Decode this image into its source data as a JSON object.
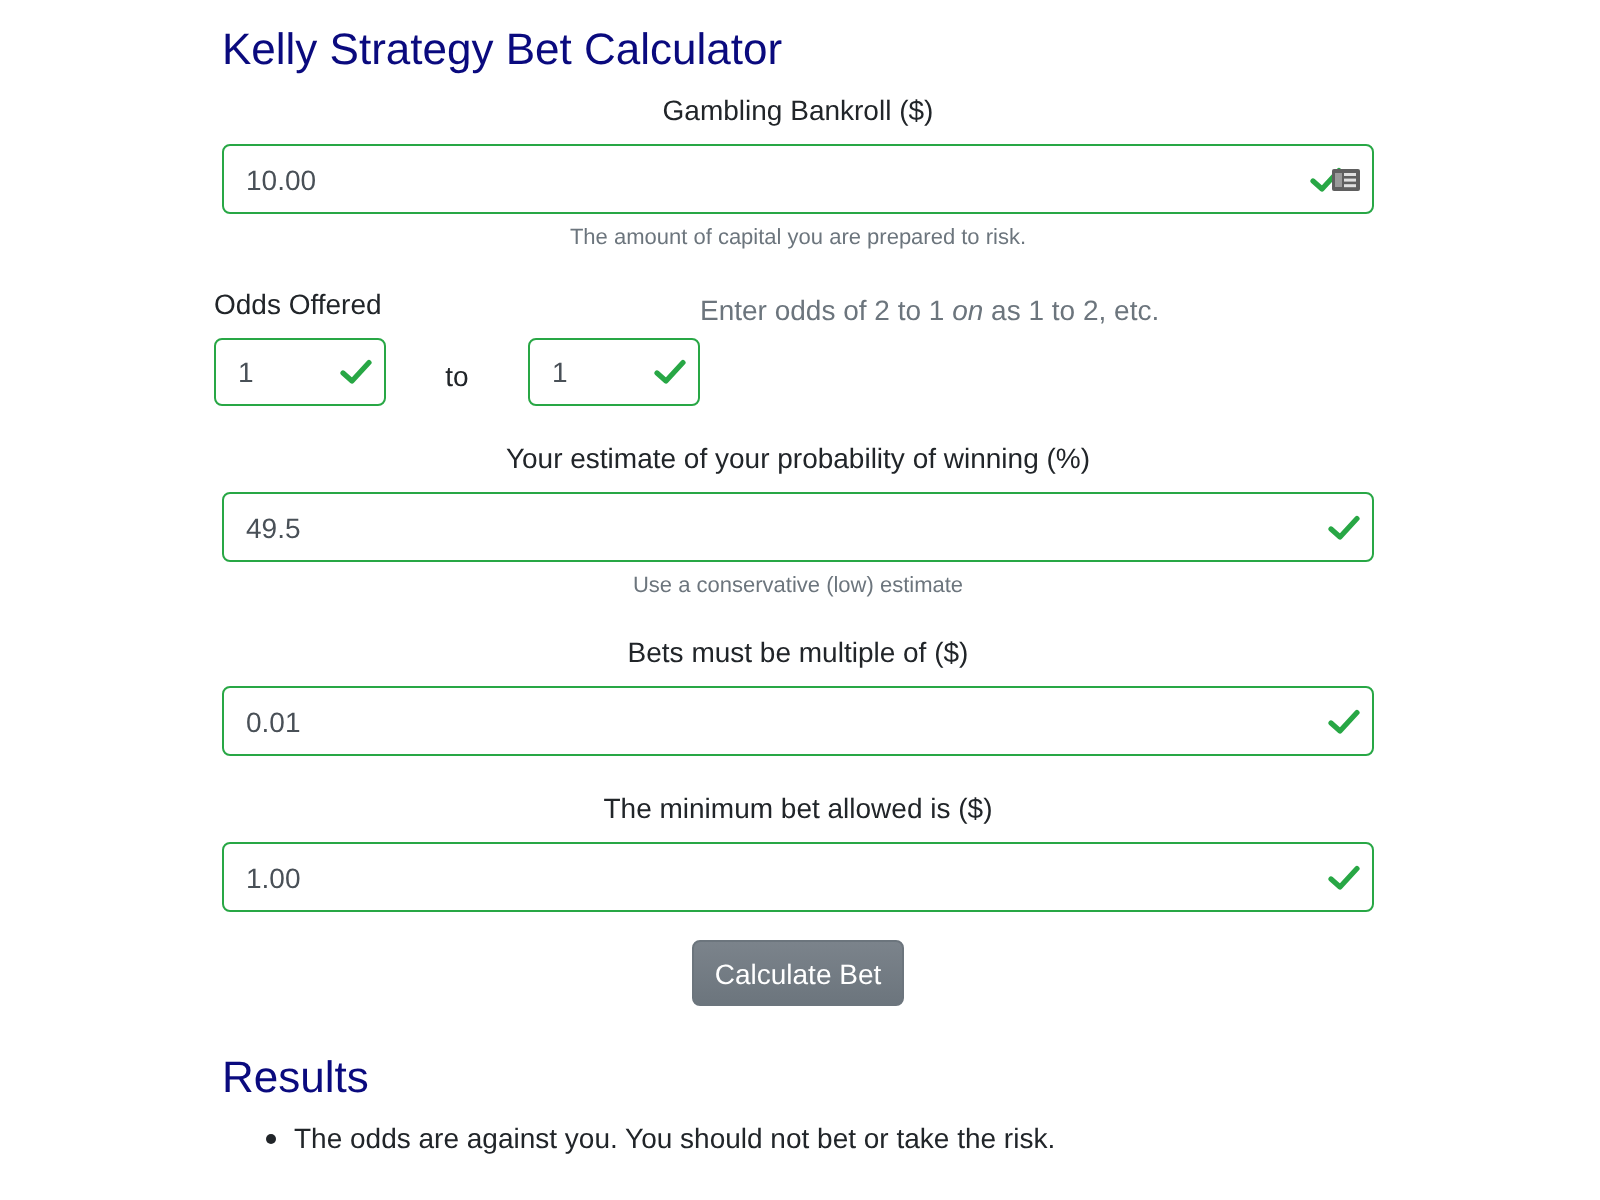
{
  "title": "Kelly Strategy Bet Calculator",
  "form": [
    {
      "kind": "field",
      "label": "Gambling Bankroll ($)",
      "value": "10.00",
      "valid": true,
      "autofill": true,
      "help": "The amount of capital you are prepared to risk."
    },
    {
      "kind": "odds",
      "label": "Odds Offered",
      "hint": "Enter odds of 2 to 1 *on* as 1 to 2, etc.",
      "separator": "to",
      "inputs": [
        {
          "value": "1",
          "valid": true
        },
        {
          "value": "1",
          "valid": true
        }
      ]
    },
    {
      "kind": "field",
      "label": "Your estimate of your probability of winning (%)",
      "value": "49.5",
      "valid": true,
      "autofill": false,
      "help": "Use a conservative (low) estimate"
    },
    {
      "kind": "field",
      "label": "Bets must be multiple of ($)",
      "value": "0.01",
      "valid": true,
      "autofill": false
    },
    {
      "kind": "field",
      "label": "The minimum bet allowed is ($)",
      "value": "1.00",
      "valid": true,
      "autofill": false
    }
  ],
  "button": "Calculate Bet",
  "results": {
    "heading": "Results",
    "items": [
      "The odds are against you. You should not bet or take the risk."
    ]
  }
}
